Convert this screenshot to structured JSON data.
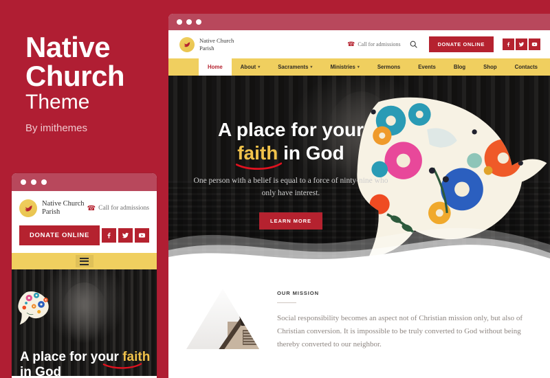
{
  "promo": {
    "title_line1": "Native",
    "title_line2": "Church",
    "subtitle": "Theme",
    "author": "By imithemes",
    "bg_color": "#b01e33"
  },
  "colors": {
    "brand_red": "#b5222f",
    "bg_red": "#b01e33",
    "chrome_red": "#b8485c",
    "nav_gold": "#f0cf5f",
    "accent_gold": "#f0c24b"
  },
  "browser": {
    "dots": [
      "dot-1",
      "dot-2",
      "dot-3"
    ]
  },
  "site": {
    "logo_icon": "dove-logo-icon",
    "brand_line1": "Native Church",
    "brand_line2": "Parish",
    "phone_icon": "phone-icon",
    "phone_label": "Call for admissions",
    "search_icon": "search-icon",
    "donate_label": "DONATE ONLINE",
    "socials": [
      {
        "name": "facebook-icon",
        "label": "Facebook"
      },
      {
        "name": "twitter-icon",
        "label": "Twitter"
      },
      {
        "name": "youtube-icon",
        "label": "YouTube"
      }
    ],
    "nav": [
      {
        "label": "Home",
        "active": true,
        "dropdown": false
      },
      {
        "label": "About",
        "active": false,
        "dropdown": true
      },
      {
        "label": "Sacraments",
        "active": false,
        "dropdown": true
      },
      {
        "label": "Ministries",
        "active": false,
        "dropdown": true
      },
      {
        "label": "Sermons",
        "active": false,
        "dropdown": false
      },
      {
        "label": "Events",
        "active": false,
        "dropdown": false
      },
      {
        "label": "Blog",
        "active": false,
        "dropdown": false
      },
      {
        "label": "Shop",
        "active": false,
        "dropdown": false
      },
      {
        "label": "Contacts",
        "active": false,
        "dropdown": false
      }
    ],
    "caret_glyph": "▾"
  },
  "hero": {
    "title_part1": "A place for your",
    "title_highlight": "faith",
    "title_part2": " in God",
    "subtitle": "One person with a belief is equal to a force of ninty-nine who only have interest.",
    "cta_label": "LEARN MORE",
    "dove_icon": "floral-dove-illustration"
  },
  "mission": {
    "label": "OUR MISSION",
    "figure": "church-roof-triangle-photo",
    "text": "Social responsibility becomes an aspect not of Christian mission only, but also of Christian conversion. It is impossible to be truly converted to God without being thereby converted to our neighbor."
  },
  "mobile": {
    "menu_icon": "hamburger-menu-icon",
    "hero_line1_part1": "A place for your ",
    "hero_line1_highlight": "faith",
    "hero_line2": "in God"
  }
}
